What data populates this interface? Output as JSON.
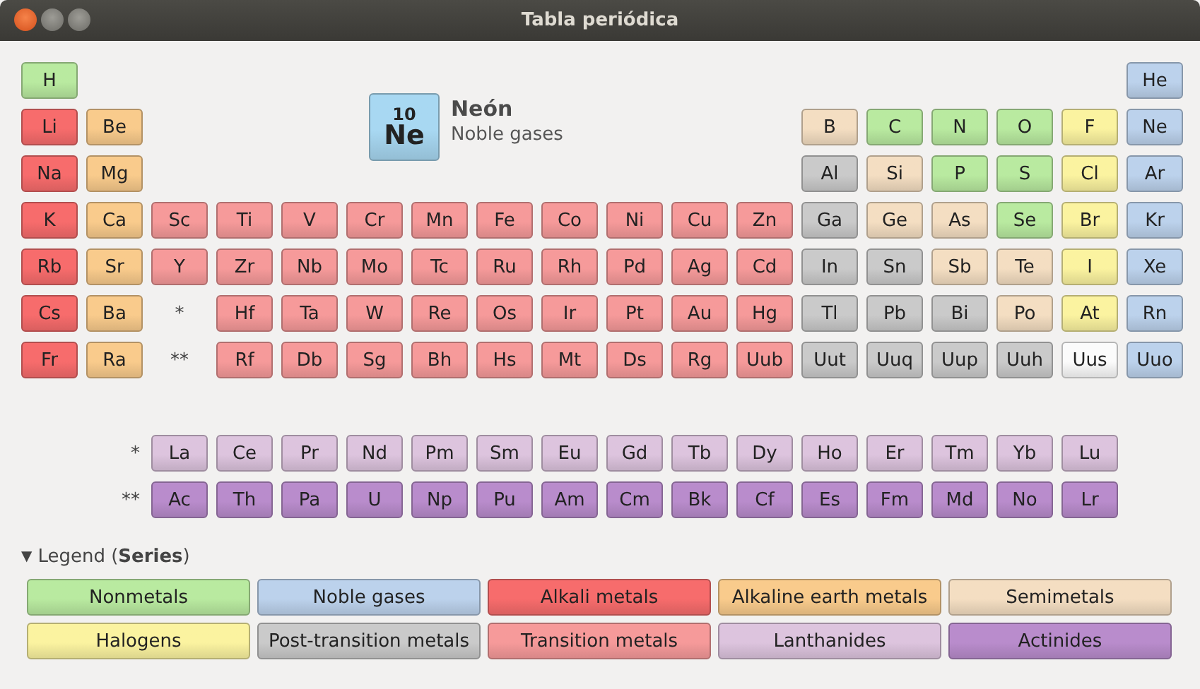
{
  "window": {
    "title": "Tabla periódica"
  },
  "info": {
    "number": "10",
    "symbol": "Ne",
    "name": "Neón",
    "series": "Noble gases",
    "color": "#a8d8f2"
  },
  "rows": [
    {
      "left": [
        {
          "kind": "element",
          "symbol": "H",
          "color": "#b9eaa0"
        }
      ],
      "right": [
        {
          "kind": "element",
          "symbol": "He",
          "color": "#bcd2ec"
        }
      ]
    },
    {
      "left": [
        {
          "kind": "element",
          "symbol": "Li",
          "color": "#f76c6c"
        },
        {
          "kind": "element",
          "symbol": "Be",
          "color": "#f9cb8c"
        }
      ],
      "right": [
        {
          "kind": "element",
          "symbol": "B",
          "color": "#f4dec2"
        },
        {
          "kind": "element",
          "symbol": "C",
          "color": "#b9eaa0"
        },
        {
          "kind": "element",
          "symbol": "N",
          "color": "#b9eaa0"
        },
        {
          "kind": "element",
          "symbol": "O",
          "color": "#b9eaa0"
        },
        {
          "kind": "element",
          "symbol": "F",
          "color": "#fbf3a0"
        },
        {
          "kind": "element",
          "symbol": "Ne",
          "color": "#bcd2ec"
        }
      ]
    },
    {
      "left": [
        {
          "kind": "element",
          "symbol": "Na",
          "color": "#f76c6c"
        },
        {
          "kind": "element",
          "symbol": "Mg",
          "color": "#f9cb8c"
        }
      ],
      "right": [
        {
          "kind": "element",
          "symbol": "Al",
          "color": "#cacaca"
        },
        {
          "kind": "element",
          "symbol": "Si",
          "color": "#f4dec2"
        },
        {
          "kind": "element",
          "symbol": "P",
          "color": "#b9eaa0"
        },
        {
          "kind": "element",
          "symbol": "S",
          "color": "#b9eaa0"
        },
        {
          "kind": "element",
          "symbol": "Cl",
          "color": "#fbf3a0"
        },
        {
          "kind": "element",
          "symbol": "Ar",
          "color": "#bcd2ec"
        }
      ]
    },
    {
      "left": [
        {
          "kind": "element",
          "symbol": "K",
          "color": "#f76c6c"
        },
        {
          "kind": "element",
          "symbol": "Ca",
          "color": "#f9cb8c"
        }
      ],
      "middle": [
        {
          "kind": "element",
          "symbol": "Sc",
          "color": "#f69a9a"
        },
        {
          "kind": "element",
          "symbol": "Ti",
          "color": "#f69a9a"
        },
        {
          "kind": "element",
          "symbol": "V",
          "color": "#f69a9a"
        },
        {
          "kind": "element",
          "symbol": "Cr",
          "color": "#f69a9a"
        },
        {
          "kind": "element",
          "symbol": "Mn",
          "color": "#f69a9a"
        },
        {
          "kind": "element",
          "symbol": "Fe",
          "color": "#f69a9a"
        },
        {
          "kind": "element",
          "symbol": "Co",
          "color": "#f69a9a"
        },
        {
          "kind": "element",
          "symbol": "Ni",
          "color": "#f69a9a"
        },
        {
          "kind": "element",
          "symbol": "Cu",
          "color": "#f69a9a"
        },
        {
          "kind": "element",
          "symbol": "Zn",
          "color": "#f69a9a"
        }
      ],
      "right": [
        {
          "kind": "element",
          "symbol": "Ga",
          "color": "#cacaca"
        },
        {
          "kind": "element",
          "symbol": "Ge",
          "color": "#f4dec2"
        },
        {
          "kind": "element",
          "symbol": "As",
          "color": "#f4dec2"
        },
        {
          "kind": "element",
          "symbol": "Se",
          "color": "#b9eaa0"
        },
        {
          "kind": "element",
          "symbol": "Br",
          "color": "#fbf3a0"
        },
        {
          "kind": "element",
          "symbol": "Kr",
          "color": "#bcd2ec"
        }
      ]
    },
    {
      "left": [
        {
          "kind": "element",
          "symbol": "Rb",
          "color": "#f76c6c"
        },
        {
          "kind": "element",
          "symbol": "Sr",
          "color": "#f9cb8c"
        }
      ],
      "middle": [
        {
          "kind": "element",
          "symbol": "Y",
          "color": "#f69a9a"
        },
        {
          "kind": "element",
          "symbol": "Zr",
          "color": "#f69a9a"
        },
        {
          "kind": "element",
          "symbol": "Nb",
          "color": "#f69a9a"
        },
        {
          "kind": "element",
          "symbol": "Mo",
          "color": "#f69a9a"
        },
        {
          "kind": "element",
          "symbol": "Tc",
          "color": "#f69a9a"
        },
        {
          "kind": "element",
          "symbol": "Ru",
          "color": "#f69a9a"
        },
        {
          "kind": "element",
          "symbol": "Rh",
          "color": "#f69a9a"
        },
        {
          "kind": "element",
          "symbol": "Pd",
          "color": "#f69a9a"
        },
        {
          "kind": "element",
          "symbol": "Ag",
          "color": "#f69a9a"
        },
        {
          "kind": "element",
          "symbol": "Cd",
          "color": "#f69a9a"
        }
      ],
      "right": [
        {
          "kind": "element",
          "symbol": "In",
          "color": "#cacaca"
        },
        {
          "kind": "element",
          "symbol": "Sn",
          "color": "#cacaca"
        },
        {
          "kind": "element",
          "symbol": "Sb",
          "color": "#f4dec2"
        },
        {
          "kind": "element",
          "symbol": "Te",
          "color": "#f4dec2"
        },
        {
          "kind": "element",
          "symbol": "I",
          "color": "#fbf3a0"
        },
        {
          "kind": "element",
          "symbol": "Xe",
          "color": "#bcd2ec"
        }
      ]
    },
    {
      "left": [
        {
          "kind": "element",
          "symbol": "Cs",
          "color": "#f76c6c"
        },
        {
          "kind": "element",
          "symbol": "Ba",
          "color": "#f9cb8c"
        }
      ],
      "middle": [
        {
          "kind": "marker",
          "symbol": "*"
        },
        {
          "kind": "element",
          "symbol": "Hf",
          "color": "#f69a9a"
        },
        {
          "kind": "element",
          "symbol": "Ta",
          "color": "#f69a9a"
        },
        {
          "kind": "element",
          "symbol": "W",
          "color": "#f69a9a"
        },
        {
          "kind": "element",
          "symbol": "Re",
          "color": "#f69a9a"
        },
        {
          "kind": "element",
          "symbol": "Os",
          "color": "#f69a9a"
        },
        {
          "kind": "element",
          "symbol": "Ir",
          "color": "#f69a9a"
        },
        {
          "kind": "element",
          "symbol": "Pt",
          "color": "#f69a9a"
        },
        {
          "kind": "element",
          "symbol": "Au",
          "color": "#f69a9a"
        },
        {
          "kind": "element",
          "symbol": "Hg",
          "color": "#f69a9a"
        }
      ],
      "right": [
        {
          "kind": "element",
          "symbol": "Tl",
          "color": "#cacaca"
        },
        {
          "kind": "element",
          "symbol": "Pb",
          "color": "#cacaca"
        },
        {
          "kind": "element",
          "symbol": "Bi",
          "color": "#cacaca"
        },
        {
          "kind": "element",
          "symbol": "Po",
          "color": "#f4dec2"
        },
        {
          "kind": "element",
          "symbol": "At",
          "color": "#fbf3a0"
        },
        {
          "kind": "element",
          "symbol": "Rn",
          "color": "#bcd2ec"
        }
      ]
    },
    {
      "left": [
        {
          "kind": "element",
          "symbol": "Fr",
          "color": "#f76c6c"
        },
        {
          "kind": "element",
          "symbol": "Ra",
          "color": "#f9cb8c"
        }
      ],
      "middle": [
        {
          "kind": "marker",
          "symbol": "**"
        },
        {
          "kind": "element",
          "symbol": "Rf",
          "color": "#f69a9a"
        },
        {
          "kind": "element",
          "symbol": "Db",
          "color": "#f69a9a"
        },
        {
          "kind": "element",
          "symbol": "Sg",
          "color": "#f69a9a"
        },
        {
          "kind": "element",
          "symbol": "Bh",
          "color": "#f69a9a"
        },
        {
          "kind": "element",
          "symbol": "Hs",
          "color": "#f69a9a"
        },
        {
          "kind": "element",
          "symbol": "Mt",
          "color": "#f69a9a"
        },
        {
          "kind": "element",
          "symbol": "Ds",
          "color": "#f69a9a"
        },
        {
          "kind": "element",
          "symbol": "Rg",
          "color": "#f69a9a"
        },
        {
          "kind": "element",
          "symbol": "Uub",
          "color": "#f69a9a"
        }
      ],
      "right": [
        {
          "kind": "element",
          "symbol": "Uut",
          "color": "#cacaca"
        },
        {
          "kind": "element",
          "symbol": "Uuq",
          "color": "#cacaca"
        },
        {
          "kind": "element",
          "symbol": "Uup",
          "color": "#cacaca"
        },
        {
          "kind": "element",
          "symbol": "Uuh",
          "color": "#cacaca"
        },
        {
          "kind": "element",
          "symbol": "Uus",
          "color": "#fbfbfb"
        },
        {
          "kind": "element",
          "symbol": "Uuo",
          "color": "#bcd2ec"
        }
      ]
    }
  ],
  "f_rows": [
    {
      "cells": [
        {
          "kind": "marker",
          "symbol": "*"
        },
        {
          "kind": "element",
          "symbol": "La",
          "color": "#ddc4de"
        },
        {
          "kind": "element",
          "symbol": "Ce",
          "color": "#ddc4de"
        },
        {
          "kind": "element",
          "symbol": "Pr",
          "color": "#ddc4de"
        },
        {
          "kind": "element",
          "symbol": "Nd",
          "color": "#ddc4de"
        },
        {
          "kind": "element",
          "symbol": "Pm",
          "color": "#ddc4de"
        },
        {
          "kind": "element",
          "symbol": "Sm",
          "color": "#ddc4de"
        },
        {
          "kind": "element",
          "symbol": "Eu",
          "color": "#ddc4de"
        },
        {
          "kind": "element",
          "symbol": "Gd",
          "color": "#ddc4de"
        },
        {
          "kind": "element",
          "symbol": "Tb",
          "color": "#ddc4de"
        },
        {
          "kind": "element",
          "symbol": "Dy",
          "color": "#ddc4de"
        },
        {
          "kind": "element",
          "symbol": "Ho",
          "color": "#ddc4de"
        },
        {
          "kind": "element",
          "symbol": "Er",
          "color": "#ddc4de"
        },
        {
          "kind": "element",
          "symbol": "Tm",
          "color": "#ddc4de"
        },
        {
          "kind": "element",
          "symbol": "Yb",
          "color": "#ddc4de"
        },
        {
          "kind": "element",
          "symbol": "Lu",
          "color": "#ddc4de"
        }
      ]
    },
    {
      "cells": [
        {
          "kind": "marker",
          "symbol": "**"
        },
        {
          "kind": "element",
          "symbol": "Ac",
          "color": "#b98ccc"
        },
        {
          "kind": "element",
          "symbol": "Th",
          "color": "#b98ccc"
        },
        {
          "kind": "element",
          "symbol": "Pa",
          "color": "#b98ccc"
        },
        {
          "kind": "element",
          "symbol": "U",
          "color": "#b98ccc"
        },
        {
          "kind": "element",
          "symbol": "Np",
          "color": "#b98ccc"
        },
        {
          "kind": "element",
          "symbol": "Pu",
          "color": "#b98ccc"
        },
        {
          "kind": "element",
          "symbol": "Am",
          "color": "#b98ccc"
        },
        {
          "kind": "element",
          "symbol": "Cm",
          "color": "#b98ccc"
        },
        {
          "kind": "element",
          "symbol": "Bk",
          "color": "#b98ccc"
        },
        {
          "kind": "element",
          "symbol": "Cf",
          "color": "#b98ccc"
        },
        {
          "kind": "element",
          "symbol": "Es",
          "color": "#b98ccc"
        },
        {
          "kind": "element",
          "symbol": "Fm",
          "color": "#b98ccc"
        },
        {
          "kind": "element",
          "symbol": "Md",
          "color": "#b98ccc"
        },
        {
          "kind": "element",
          "symbol": "No",
          "color": "#b98ccc"
        },
        {
          "kind": "element",
          "symbol": "Lr",
          "color": "#b98ccc"
        }
      ]
    }
  ],
  "legend": {
    "toggle": "▼",
    "title": "Legend (**Series**)",
    "expanded": true,
    "items": [
      {
        "label": "Nonmetals",
        "color": "#b9eaa0"
      },
      {
        "label": "Noble gases",
        "color": "#bcd2ec"
      },
      {
        "label": "Alkali metals",
        "color": "#f76c6c"
      },
      {
        "label": "Alkaline earth metals",
        "color": "#f9cb8c"
      },
      {
        "label": "Semimetals",
        "color": "#f4dec2"
      },
      {
        "label": "Halogens",
        "color": "#fbf3a0"
      },
      {
        "label": "Post-transition metals",
        "color": "#cacaca"
      },
      {
        "label": "Transition metals",
        "color": "#f69a9a"
      },
      {
        "label": "Lanthanides",
        "color": "#ddc4de"
      },
      {
        "label": "Actinides",
        "color": "#b98ccc"
      }
    ]
  }
}
